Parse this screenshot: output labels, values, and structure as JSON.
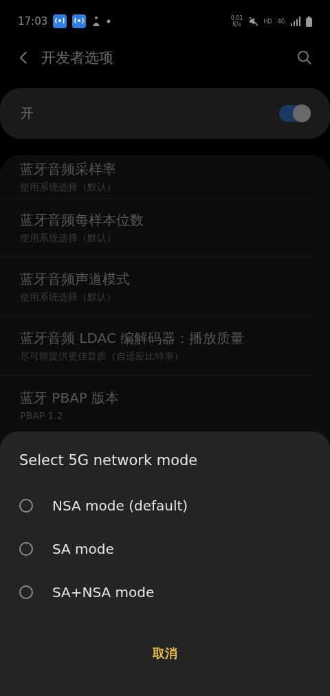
{
  "status_bar": {
    "time": "17:03",
    "net_speed": "0.01",
    "net_unit": "K/s",
    "hd": "HD",
    "network": "4G"
  },
  "app_bar": {
    "title": "开发者选项"
  },
  "master_switch": {
    "label": "开",
    "on": true
  },
  "settings": [
    {
      "title": "蓝牙音频采样率",
      "summary": "使用系统选择（默认）"
    },
    {
      "title": "蓝牙音频每样本位数",
      "summary": "使用系统选择（默认）"
    },
    {
      "title": "蓝牙音频声道模式",
      "summary": "使用系统选择（默认）"
    },
    {
      "title": "蓝牙音频 LDAC 编解码器：播放质量",
      "summary": "尽可能提供更佳音质（自适应比特率）"
    },
    {
      "title": "蓝牙 PBAP 版本",
      "summary": "PBAP 1.2"
    }
  ],
  "dialog": {
    "title": "Select 5G network mode",
    "options": [
      {
        "label": "NSA mode (default)",
        "selected": false
      },
      {
        "label": "SA mode",
        "selected": false
      },
      {
        "label": "SA+NSA mode",
        "selected": false
      }
    ],
    "cancel": "取消"
  }
}
